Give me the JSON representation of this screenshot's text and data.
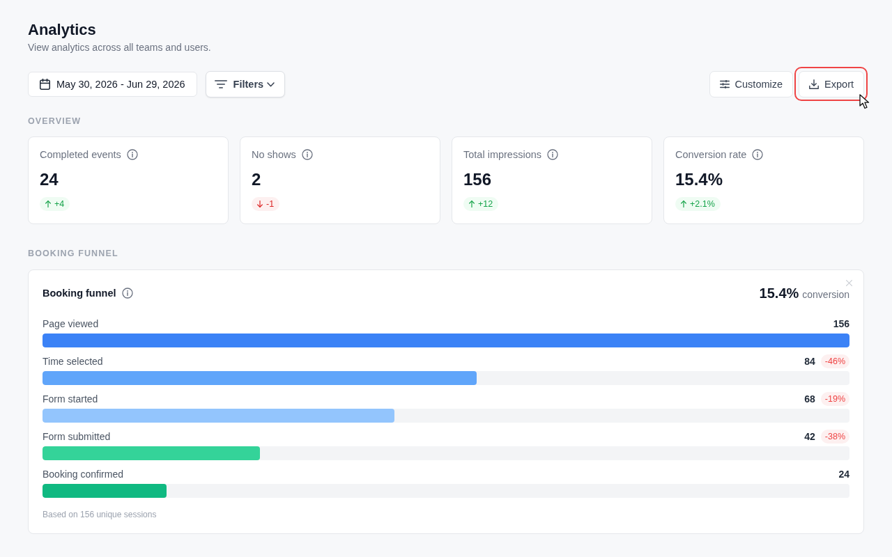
{
  "header": {
    "title": "Analytics",
    "subtitle": "View analytics across all teams and users."
  },
  "toolbar": {
    "left": [
      {
        "kind": "date_range",
        "label": "May 30, 2026 - Jun 29, 2026"
      },
      {
        "kind": "filters",
        "label": "Filters"
      }
    ],
    "right": [
      {
        "kind": "customize",
        "label": "Customize",
        "focused": false,
        "hovered": false
      },
      {
        "kind": "export",
        "label": "Export",
        "focused": true,
        "hovered": true
      }
    ]
  },
  "overview": {
    "heading": "OVERVIEW",
    "cards": [
      {
        "label": "Completed events",
        "value": "24",
        "change": {
          "kind": "up",
          "text": "+4"
        }
      },
      {
        "label": "No shows",
        "value": "2",
        "change": {
          "kind": "down",
          "text": "-1"
        }
      },
      {
        "label": "Total impressions",
        "value": "156",
        "change": {
          "kind": "up",
          "text": "+12"
        }
      },
      {
        "label": "Conversion rate",
        "value": "15.4%",
        "change": {
          "kind": "up",
          "text": "+2.1%"
        }
      }
    ]
  },
  "booking_funnel": {
    "heading": "BOOKING FUNNEL",
    "title": "Booking funnel",
    "dismissible": true,
    "conversion": {
      "value": "15.4%",
      "label": "conversion"
    },
    "steps": [
      {
        "label": "Page viewed",
        "count": "156",
        "level": 1.0,
        "color": "#3b82f6"
      },
      {
        "label": "Time selected",
        "count": "84",
        "drop": "-46%",
        "level": 0.538,
        "color": "#60a5fa"
      },
      {
        "label": "Form started",
        "count": "68",
        "drop": "-19%",
        "level": 0.436,
        "color": "#93c5fd"
      },
      {
        "label": "Form submitted",
        "count": "42",
        "drop": "-38%",
        "level": 0.269,
        "color": "#34d399"
      },
      {
        "label": "Booking confirmed",
        "count": "24",
        "level": 0.154,
        "color": "#10b981"
      }
    ],
    "footnote": "Based on 156 unique sessions"
  }
}
